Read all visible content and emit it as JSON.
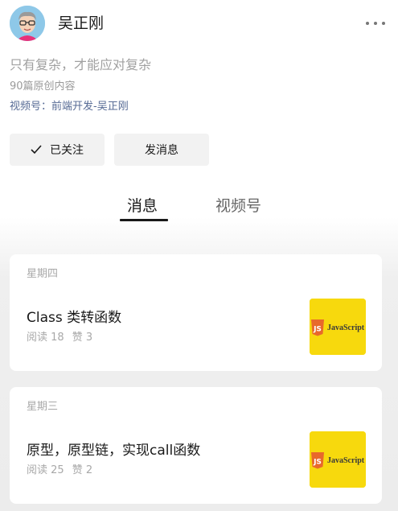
{
  "profile": {
    "name": "吴正刚",
    "bio": "只有复杂，才能应对复杂",
    "article_count": "90篇原创内容",
    "channel": "视频号：前端开发-吴正刚"
  },
  "actions": {
    "follow_label": "已关注",
    "message_label": "发消息"
  },
  "tabs": [
    {
      "label": "消息",
      "active": true
    },
    {
      "label": "视频号",
      "active": false
    }
  ],
  "posts": [
    {
      "day": "星期四",
      "title": "Class 类转函数",
      "reads": "阅读 18",
      "likes": "赞 3",
      "thumb_badge": "JS",
      "thumb_label": "JavaScript"
    },
    {
      "day": "星期三",
      "title": "原型，原型链，实现call函数",
      "reads": "阅读 25",
      "likes": "赞 2",
      "thumb_badge": "JS",
      "thumb_label": "JavaScript"
    }
  ],
  "colors": {
    "link": "#576b95",
    "thumb_bg": "#f7d90d",
    "js_badge": "#e8692b"
  }
}
